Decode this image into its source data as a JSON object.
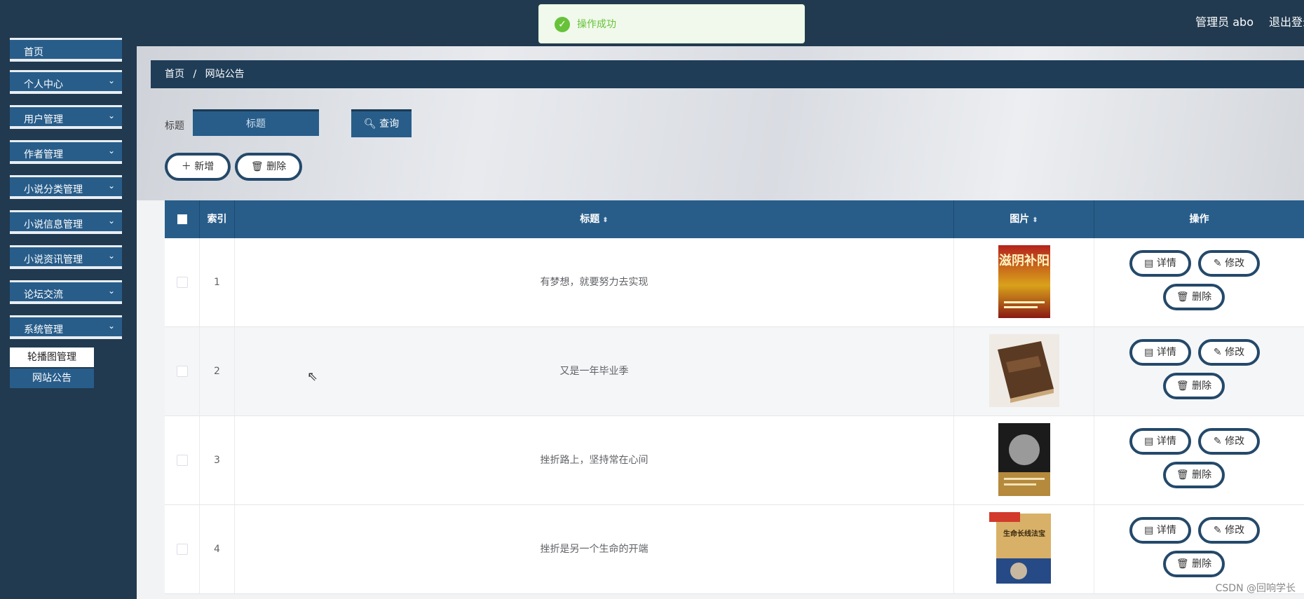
{
  "header": {
    "user_label": "管理员 abo",
    "logout_label": "退出登录",
    "toast_message": "操作成功"
  },
  "sidebar": {
    "top_item": "首页",
    "items": [
      {
        "label": "个人中心"
      },
      {
        "label": "用户管理"
      },
      {
        "label": "作者管理"
      },
      {
        "label": "小说分类管理"
      },
      {
        "label": "小说信息管理"
      },
      {
        "label": "小说资讯管理"
      },
      {
        "label": "论坛交流"
      },
      {
        "label": "系统管理"
      }
    ],
    "subitems": [
      {
        "label": "轮播图管理",
        "active": false
      },
      {
        "label": "网站公告",
        "active": true
      }
    ]
  },
  "breadcrumb": {
    "home": "首页",
    "separator": "/",
    "current": "网站公告"
  },
  "search": {
    "label": "标题",
    "placeholder": "标题",
    "button_label": "查询"
  },
  "toolbar": {
    "add_label": "新增",
    "delete_label": "删除"
  },
  "table": {
    "headers": {
      "index": "索引",
      "title": "标题",
      "image": "图片",
      "action": "操作"
    },
    "rows": [
      {
        "index": "1",
        "title": "有梦想，就要努力去实现",
        "cover_text": "滋阴补阳"
      },
      {
        "index": "2",
        "title": "又是一年毕业季",
        "cover_text": ""
      },
      {
        "index": "3",
        "title": "挫折路上，坚持常在心间",
        "cover_text": ""
      },
      {
        "index": "4",
        "title": "挫折是另一个生命的开端",
        "cover_text": "生命长线法宝"
      }
    ],
    "row_actions": {
      "detail": "详情",
      "edit": "修改",
      "delete": "删除"
    }
  },
  "watermark": "CSDN @回响学长",
  "colors": {
    "header_bg": "#213a50",
    "primary": "#285d8a",
    "pill_border": "#24496a",
    "success": "#67c23a"
  }
}
